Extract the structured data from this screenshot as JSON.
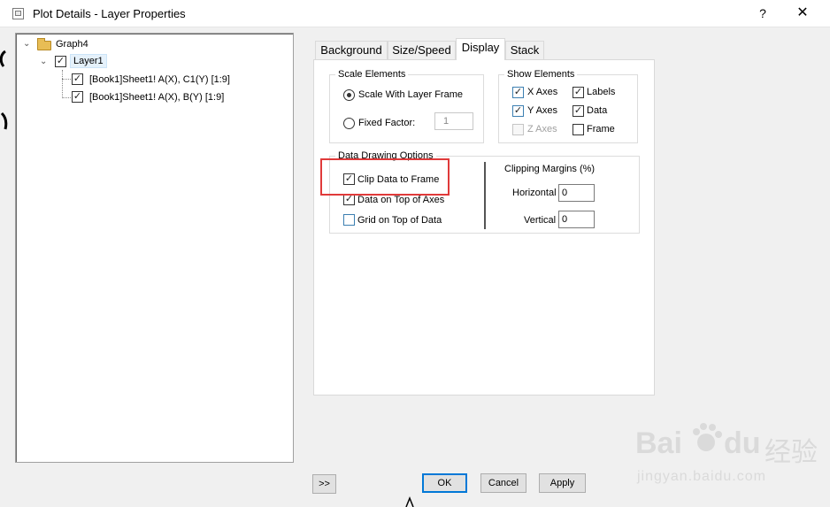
{
  "window": {
    "title": "Plot Details - Layer Properties",
    "help_label": "?",
    "close_label": "✕"
  },
  "tree": {
    "root": "Graph4",
    "layer": "Layer1",
    "plots": [
      "[Book1]Sheet1! A(X), C1(Y) [1:9]",
      "[Book1]Sheet1! A(X), B(Y) [1:9]"
    ]
  },
  "tabs": [
    "Background",
    "Size/Speed",
    "Display",
    "Stack"
  ],
  "active_tab": "Display",
  "scale_elements": {
    "legend": "Scale Elements",
    "scale_with_layer_frame": "Scale With Layer Frame",
    "fixed_factor_label": "Fixed Factor:",
    "fixed_factor_value": "1",
    "selected": "Scale With Layer Frame"
  },
  "show_elements": {
    "legend": "Show Elements",
    "x_axes": "X Axes",
    "y_axes": "Y Axes",
    "z_axes": "Z Axes",
    "labels": "Labels",
    "data": "Data",
    "frame": "Frame",
    "checked": {
      "x_axes": true,
      "y_axes": true,
      "z_axes": false,
      "labels": true,
      "data": true,
      "frame": false
    }
  },
  "data_drawing": {
    "legend": "Data Drawing Options",
    "clip_data": "Clip Data to Frame",
    "data_on_top": "Data on Top of Axes",
    "grid_on_top": "Grid on Top of Data",
    "checked": {
      "clip_data": true,
      "data_on_top": true,
      "grid_on_top": false
    }
  },
  "clipping_margins": {
    "title": "Clipping Margins (%)",
    "horizontal_label": "Horizontal",
    "horizontal_value": "0",
    "vertical_label": "Vertical",
    "vertical_value": "0"
  },
  "buttons": {
    "expand": ">>",
    "ok": "OK",
    "cancel": "Cancel",
    "apply": "Apply"
  },
  "watermark": {
    "brand": "Bai",
    "brand_suffix": "du",
    "chinese": "经验",
    "url": "jingyan.baidu.com"
  },
  "colors": {
    "highlight": "#e03a3a",
    "default_button_border": "#0078d7",
    "selection": "#e5f1fb"
  },
  "checkmark": "✓"
}
